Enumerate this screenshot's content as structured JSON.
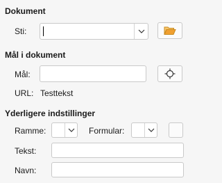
{
  "document_section": {
    "title": "Dokument",
    "path_label": "Sti:",
    "path_value": ""
  },
  "target_section": {
    "title": "Mål i dokument",
    "target_label": "Mål:",
    "target_value": "",
    "url_label": "URL:",
    "url_value": "Testtekst"
  },
  "more_settings": {
    "title": "Yderligere indstillinger",
    "frame_label": "Ramme:",
    "frame_value": "",
    "form_label": "Formular:",
    "form_value": "",
    "text_label": "Tekst:",
    "text_value": "",
    "name_label": "Navn:",
    "name_value": ""
  },
  "icons": {
    "open_file": "folder-open-icon",
    "target": "crosshair-target-icon",
    "dropdown": "chevron-down-icon"
  },
  "colors": {
    "folder": "#f0a030",
    "background": "#f6f6f6"
  }
}
